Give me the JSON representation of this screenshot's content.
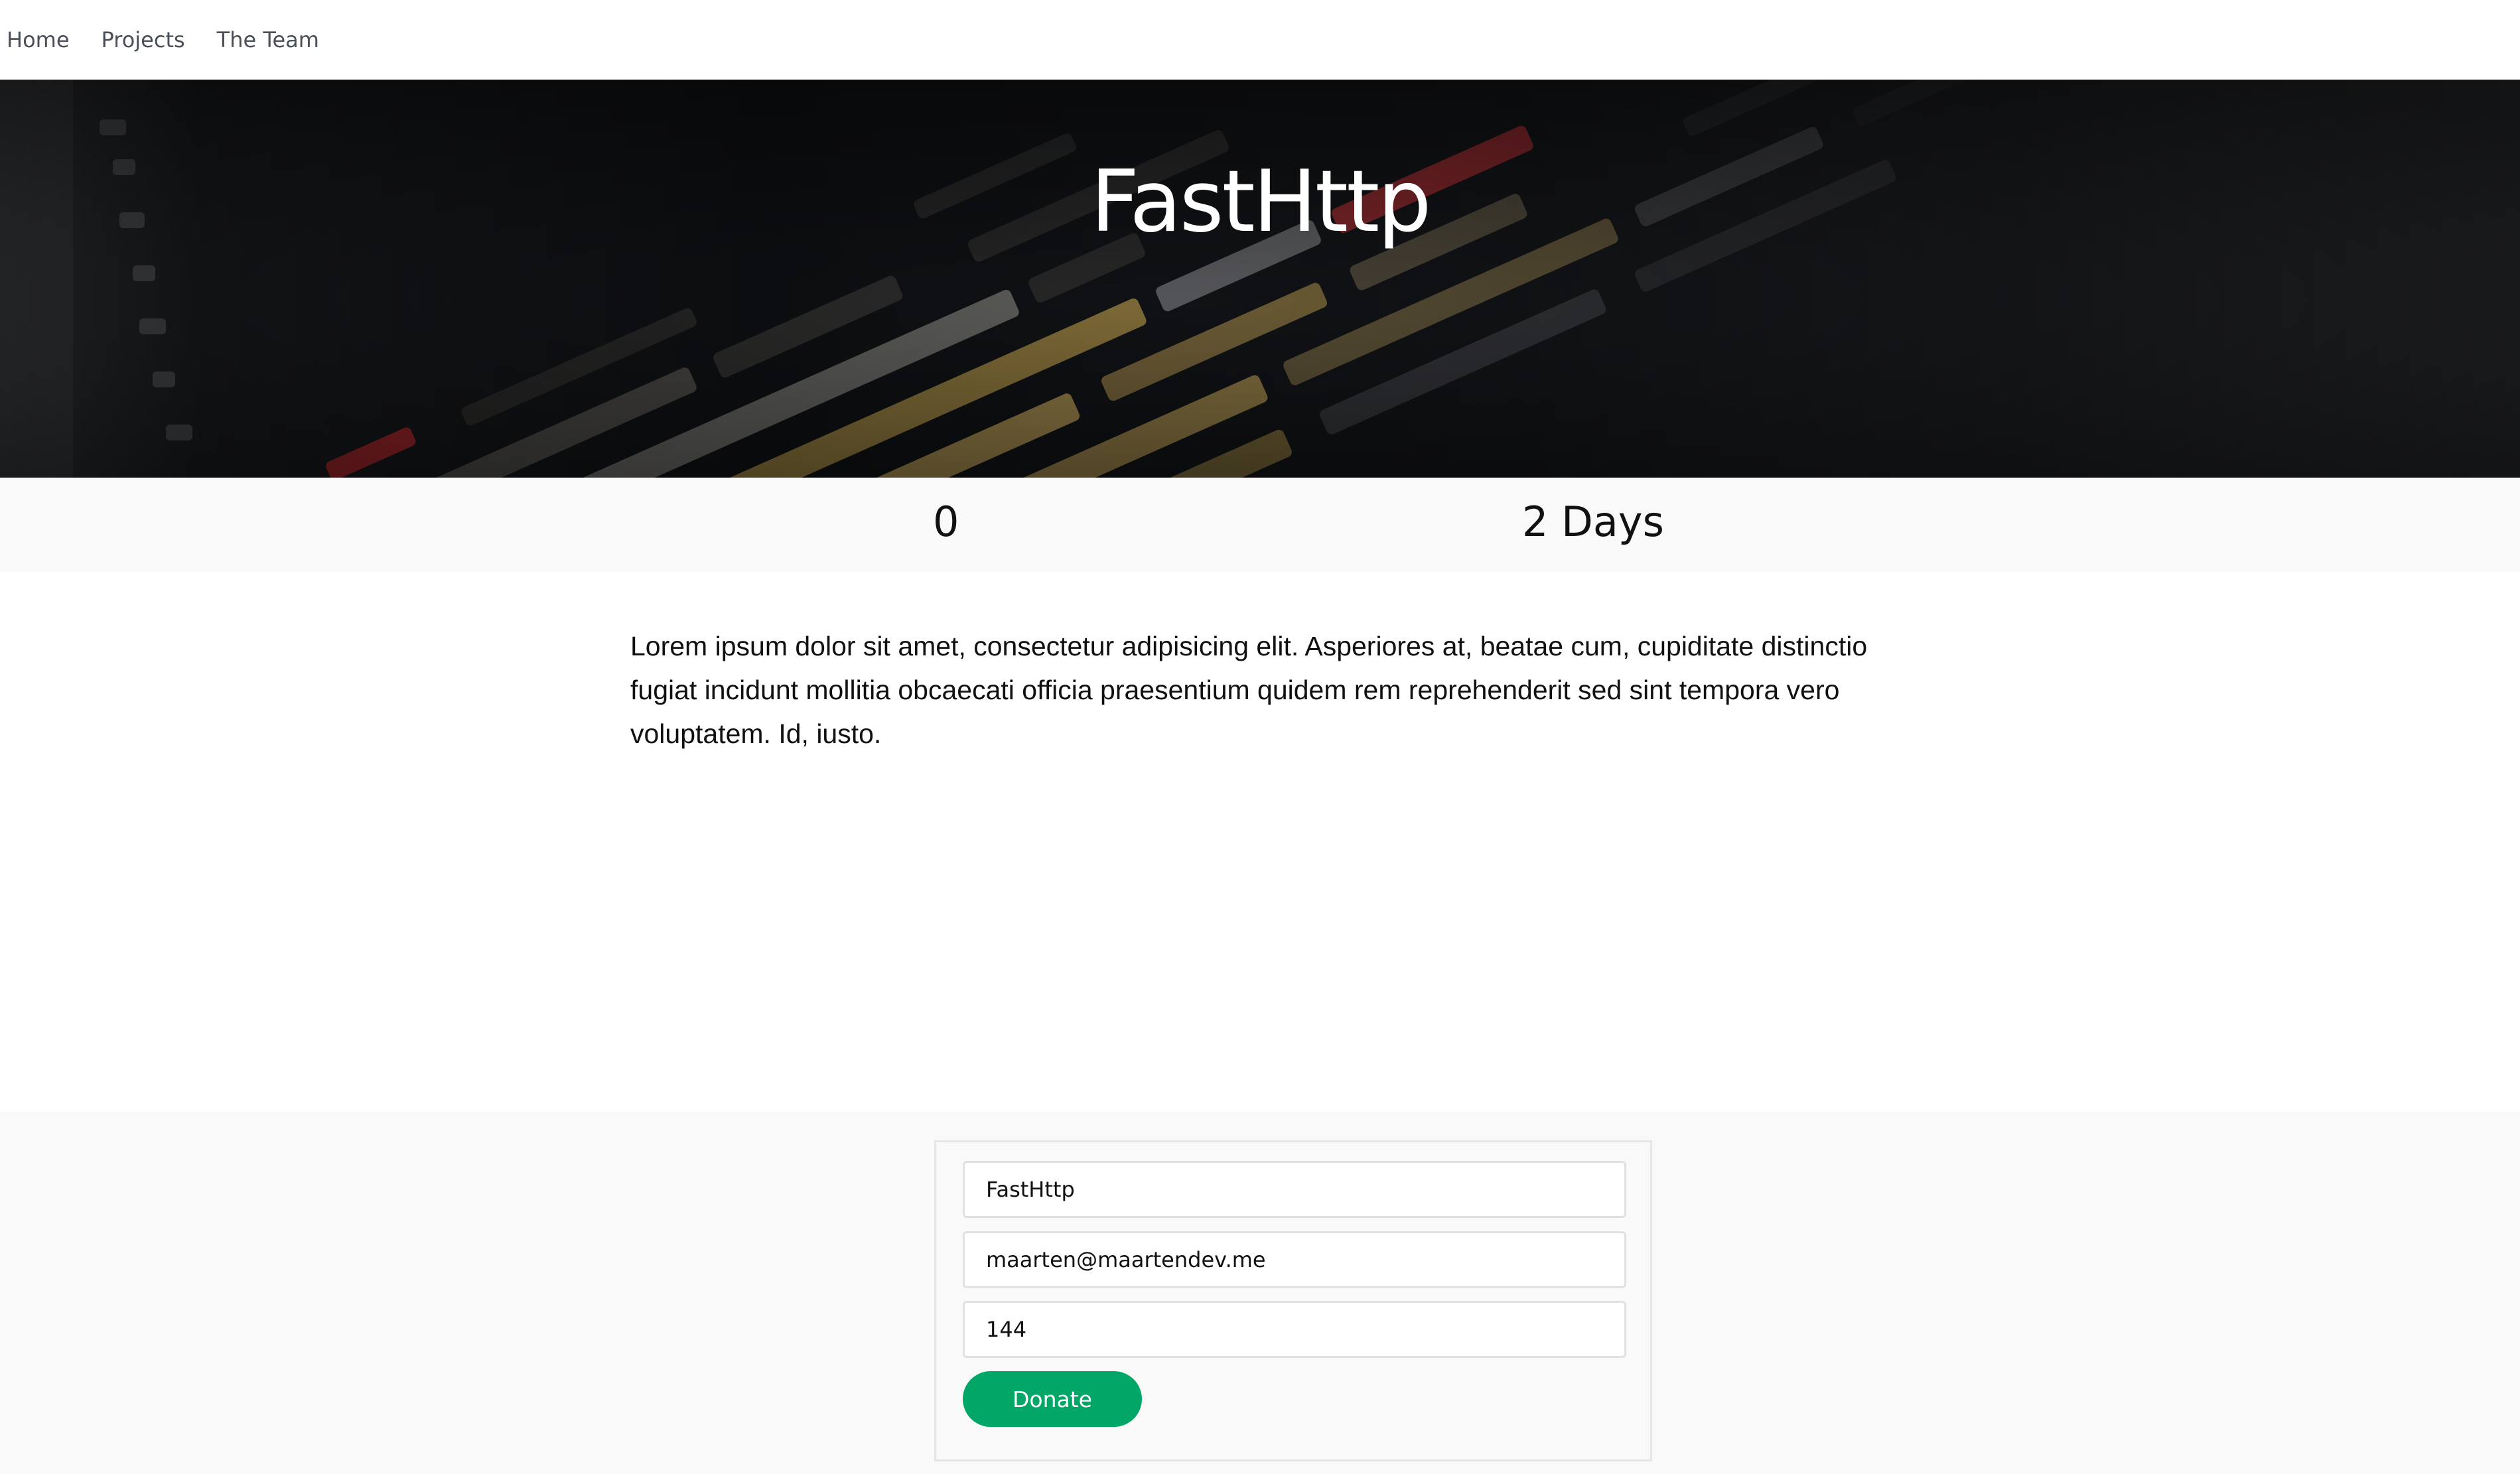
{
  "nav": {
    "items": [
      {
        "label": "Home"
      },
      {
        "label": "Projects"
      },
      {
        "label": "The Team"
      }
    ]
  },
  "hero": {
    "title": "FastHttp"
  },
  "stats": {
    "count": "0",
    "duration": "2 Days"
  },
  "description": "Lorem ipsum dolor sit amet, consectetur adipisicing elit. Asperiores at, beatae cum, cupiditate distinctio fugiat incidunt mollitia obcaecati officia praesentium quidem rem reprehenderit sed sint tempora vero voluptatem. Id, iusto.",
  "form": {
    "name_value": "FastHttp",
    "email_value": "maarten@maartendev.me",
    "amount_value": "144",
    "donate_label": "Donate"
  },
  "colors": {
    "accent": "#02a768",
    "nav_text": "#4a4f58",
    "section_bg": "#f9f9f9"
  }
}
